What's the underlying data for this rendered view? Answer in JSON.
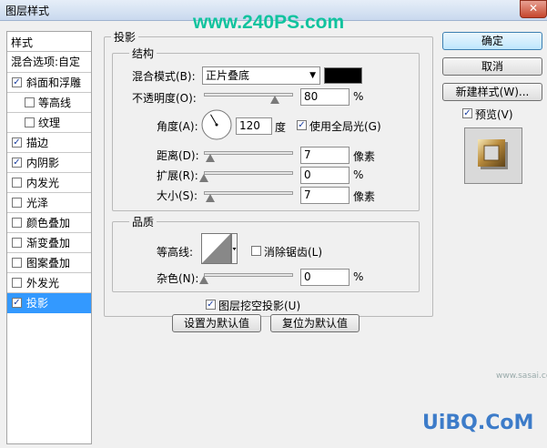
{
  "window": {
    "title": "图层样式",
    "close_label": "✕"
  },
  "watermark_top": "www.240PS.com",
  "left_panel": {
    "header": "样式",
    "blend_options": "混合选项:自定",
    "items": [
      {
        "label": "斜面和浮雕",
        "checked": true,
        "sub": false
      },
      {
        "label": "等高线",
        "checked": false,
        "sub": true
      },
      {
        "label": "纹理",
        "checked": false,
        "sub": true
      },
      {
        "label": "描边",
        "checked": true,
        "sub": false
      },
      {
        "label": "内阴影",
        "checked": true,
        "sub": false
      },
      {
        "label": "内发光",
        "checked": false,
        "sub": false
      },
      {
        "label": "光泽",
        "checked": false,
        "sub": false
      },
      {
        "label": "颜色叠加",
        "checked": false,
        "sub": false
      },
      {
        "label": "渐变叠加",
        "checked": false,
        "sub": false
      },
      {
        "label": "图案叠加",
        "checked": false,
        "sub": false
      },
      {
        "label": "外发光",
        "checked": false,
        "sub": false
      },
      {
        "label": "投影",
        "checked": true,
        "sub": false,
        "selected": true
      }
    ]
  },
  "drop_shadow": {
    "section_title": "投影",
    "structure": {
      "title": "结构",
      "blend_mode_label": "混合模式(B):",
      "blend_mode_value": "正片叠底",
      "shadow_color": "#000000",
      "opacity_label": "不透明度(O):",
      "opacity_value": "80",
      "opacity_unit": "%",
      "opacity_fraction": 0.8,
      "angle_label": "角度(A):",
      "angle_value": "120",
      "angle_unit": "度",
      "global_light_label": "使用全局光(G)",
      "global_light_checked": true,
      "distance_label": "距离(D):",
      "distance_value": "7",
      "distance_unit": "像素",
      "spread_label": "扩展(R):",
      "spread_value": "0",
      "spread_unit": "%",
      "size_label": "大小(S):",
      "size_value": "7",
      "size_unit": "像素"
    },
    "quality": {
      "title": "品质",
      "contour_label": "等高线:",
      "anti_alias_label": "消除锯齿(L)",
      "anti_alias_checked": false,
      "noise_label": "杂色(N):",
      "noise_value": "0",
      "noise_unit": "%"
    },
    "knockout_label": "图层挖空投影(U)",
    "knockout_checked": true,
    "make_default_label": "设置为默认值",
    "reset_default_label": "复位为默认值"
  },
  "buttons": {
    "ok": "确定",
    "cancel": "取消",
    "new_style": "新建样式(W)...",
    "preview_label": "预览(V)",
    "preview_checked": true
  },
  "watermark_br": "UiBQ.CoM",
  "watermark_small": "www.sasai.cc"
}
